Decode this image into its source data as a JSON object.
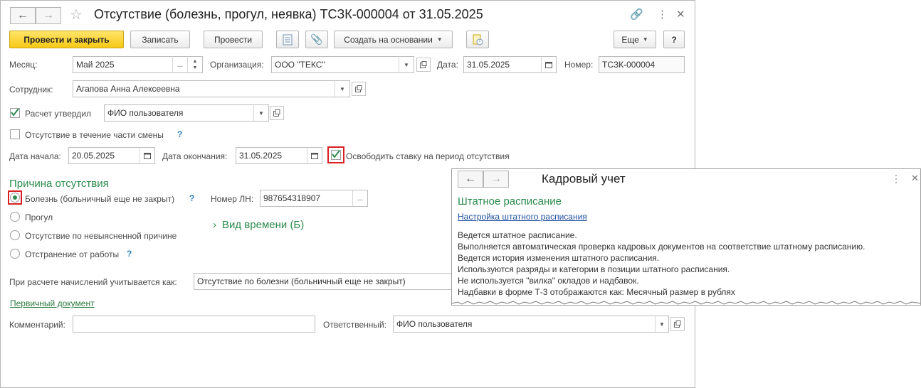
{
  "doc": {
    "title": "Отсутствие (болезнь, прогул, неявка) ТСЗК-000004 от 31.05.2025",
    "star_icon": "star-icon",
    "link_icon": "link-icon",
    "more_icon": "kebab-menu-icon",
    "close_icon": "close-icon"
  },
  "toolbar": {
    "post_close": "Провести и закрыть",
    "save": "Записать",
    "post": "Провести",
    "create_based": "Создать на основании",
    "more": "Еще",
    "help": "?"
  },
  "form": {
    "month_label": "Месяц:",
    "month_value": "Май 2025",
    "org_label": "Организация:",
    "org_value": "ООО \"ТЕКС\"",
    "date_label": "Дата:",
    "date_value": "31.05.2025",
    "number_label": "Номер:",
    "number_value": "ТСЗК-000004",
    "employee_label": "Сотрудник:",
    "employee_value": "Агапова Анна Алексеевна",
    "approved_label": "Расчет утвердил",
    "approved_value": "ФИО пользователя",
    "partial_label": "Отсутствие в течение части смены",
    "start_label": "Дата начала:",
    "start_value": "20.05.2025",
    "end_label": "Дата окончания:",
    "end_value": "31.05.2025",
    "free_rate_label": "Освободить ставку на период отсутствия",
    "reason_header": "Причина отсутствия",
    "reasons": [
      "Болезнь (больничный еще не закрыт)",
      "Прогул",
      "Отсутствие по невыясненной причине",
      "Отстранение от работы"
    ],
    "ln_label": "Номер ЛН:",
    "ln_value": "987654318907",
    "time_type": "Вид времени (Б)",
    "calc_label": "При расчете начислений учитывается как:",
    "calc_value": "Отсутствие по болезни (больничный еще не закрыт)",
    "primary_doc": "Первичный документ",
    "comment_label": "Комментарий:",
    "comment_value": "",
    "responsible_label": "Ответственный:",
    "responsible_value": "ФИО пользователя"
  },
  "popup": {
    "title": "Кадровый учет",
    "section": "Штатное расписание",
    "settings_link": "Настройка штатного расписания",
    "lines": [
      "Ведется штатное расписание.",
      "Выполняется автоматическая проверка кадровых документов на соответствие штатному расписанию.",
      "Ведется история изменения штатного расписания.",
      "Используются разряды и категории в позиции штатного расписания.",
      "Не используется \"вилка\" окладов и надбавок.",
      "Надбавки в форме Т-3 отображаются как: Месячный размер в рублях"
    ]
  },
  "colors": {
    "accent_yellow": "#f6c915",
    "green_header": "#2a8a4a",
    "highlight_red": "#d92020",
    "help_blue": "#2b7fc1"
  }
}
